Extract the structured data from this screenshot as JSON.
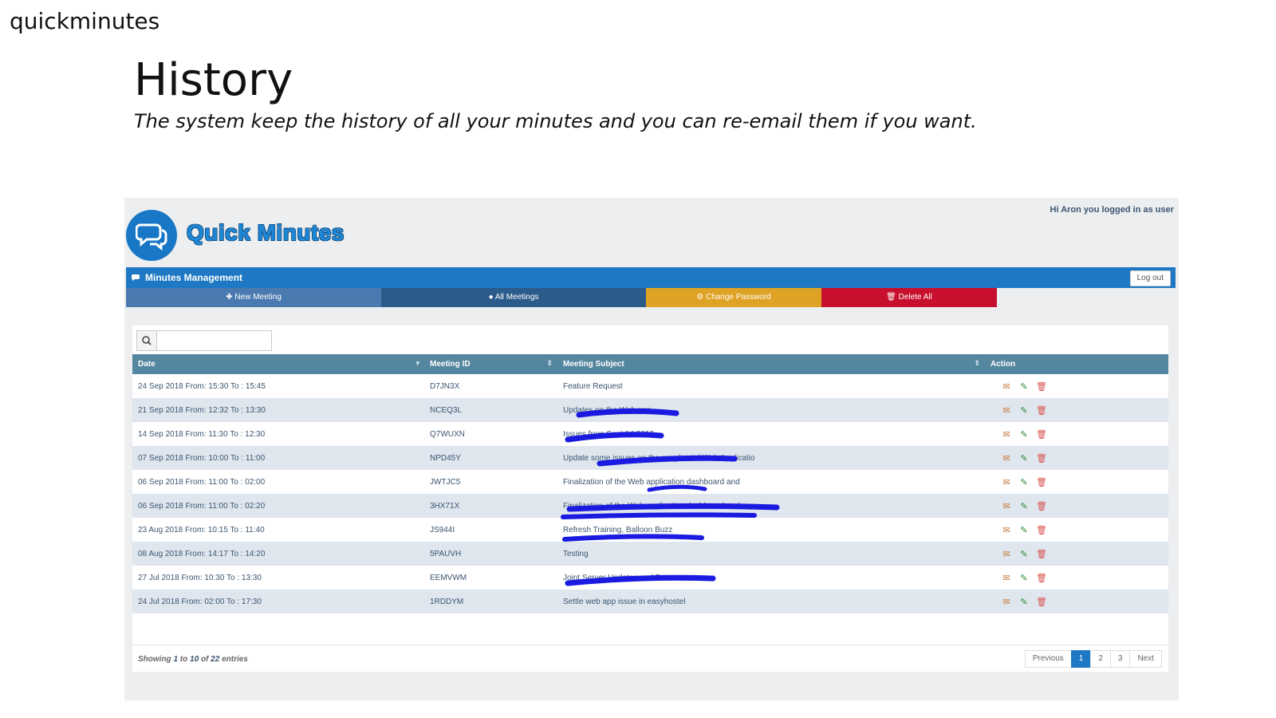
{
  "brand": "quickminutes",
  "heading": {
    "title": "History",
    "subtitle": "The system keep the history of all your minutes and you can re-email them if you want."
  },
  "app": {
    "login_info": "Hi Aron you logged in as user",
    "logo_text": "Quick Minutes",
    "bar_title": "Minutes Management",
    "logout_label": "Log out",
    "nav": {
      "new_meeting": "New Meeting",
      "all_meetings": "All Meetings",
      "change_password": "Change Password",
      "delete_all": "Delete All"
    },
    "colors": {
      "primary": "#1f78c3",
      "header_row": "#55869f",
      "change_password": "#dea224",
      "delete_all": "#c8102e"
    },
    "search": {
      "placeholder": "",
      "value": ""
    },
    "table": {
      "columns": [
        "Date",
        "Meeting ID",
        "Meeting Subject",
        "Action"
      ],
      "rows": [
        {
          "date": "24 Sep 2018 From: 15:30 To : 15:45",
          "id": "D7JN3X",
          "subject": "Feature Request"
        },
        {
          "date": "21 Sep 2018 From: 12:32 To : 13:30",
          "id": "NCEQ3L",
          "subject": "Updates on the Web app"
        },
        {
          "date": "14 Sep 2018 From: 11:30 To : 12:30",
          "id": "Q7WUXN",
          "subject": "Issues from Sept 14 2018"
        },
        {
          "date": "07 Sep 2018 From: 10:00 To : 11:00",
          "id": "NPD45Y",
          "subject": "Update some issues on the easyhostel Web Applicatio"
        },
        {
          "date": "06 Sep 2018 From: 11:00 To : 02:00",
          "id": "JWTJC5",
          "subject": "Finalization of the Web application dashboard and"
        },
        {
          "date": "06 Sep 2018 From: 11:00 To : 02:20",
          "id": "3HX71X",
          "subject": "Finalization of the Web application dashboard and"
        },
        {
          "date": "23 Aug 2018 From: 10:15 To : 11:40",
          "id": "JS944I",
          "subject": "Refresh Training, Balloon Buzz"
        },
        {
          "date": "08 Aug 2018 From: 14:17 To : 14:20",
          "id": "5PAUVH",
          "subject": "Testing"
        },
        {
          "date": "27 Jul 2018 From: 10:30 To : 13:30",
          "id": "EEMVWM",
          "subject": "Joint Server Updates and Demo"
        },
        {
          "date": "24 Jul 2018 From: 02:00 To : 17:30",
          "id": "1RDDYM",
          "subject": "Settle web app issue in easyhostel"
        }
      ],
      "action_icons": [
        "mail-icon",
        "pencil-icon",
        "trash-icon"
      ]
    },
    "footer": {
      "showing_prefix": "Showing",
      "from": "1",
      "to_word": "to",
      "to": "10",
      "of_word": "of",
      "total": "22",
      "entries_word": "entries"
    },
    "pagination": {
      "previous": "Previous",
      "pages": [
        "1",
        "2",
        "3"
      ],
      "current": "1",
      "next": "Next"
    }
  }
}
